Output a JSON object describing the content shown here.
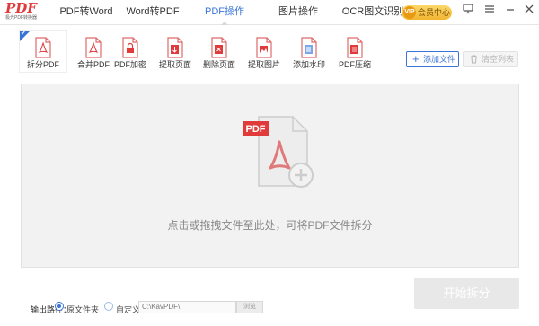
{
  "app": {
    "logo_text": "PDF",
    "logo_subtitle": "极光PDF转换器"
  },
  "main_tabs": [
    {
      "label": "PDF转Word",
      "active": false
    },
    {
      "label": "Word转PDF",
      "active": false
    },
    {
      "label": "PDF操作",
      "active": true
    },
    {
      "label": "图片操作",
      "active": false
    },
    {
      "label": "OCR图文识别",
      "active": false
    }
  ],
  "header": {
    "vip_label": "会员中心",
    "vip_badge": "VIP"
  },
  "window_controls": [
    "user-icon",
    "menu-icon",
    "minimize-icon",
    "close-icon"
  ],
  "tools": [
    {
      "label": "拆分PDF",
      "icon": "split-pdf-icon",
      "active": true
    },
    {
      "label": "合并PDF",
      "icon": "merge-pdf-icon",
      "active": false
    },
    {
      "label": "PDF加密",
      "icon": "encrypt-pdf-icon",
      "active": false
    },
    {
      "label": "提取页面",
      "icon": "extract-pages-icon",
      "active": false
    },
    {
      "label": "删除页面",
      "icon": "delete-pages-icon",
      "active": false
    },
    {
      "label": "提取图片",
      "icon": "extract-images-icon",
      "active": false
    },
    {
      "label": "添加水印",
      "icon": "add-watermark-icon",
      "active": false
    },
    {
      "label": "PDF压缩",
      "icon": "compress-pdf-icon",
      "active": false
    }
  ],
  "actions": {
    "add_file": "添加文件",
    "clear_list": "清空列表"
  },
  "dropzone": {
    "badge": "PDF",
    "hint": "点击或拖拽文件至此处，可将PDF文件拆分"
  },
  "output": {
    "label": "输出路径：",
    "option_original": "原文件夹",
    "option_custom": "自定义",
    "selected": "原文件夹",
    "path": "C:\\KavPDF\\",
    "browse": "浏览"
  },
  "start_button": "开始拆分",
  "colors": {
    "accent": "#3a74d6",
    "pdf_red": "#e03a3a",
    "dropzone_bg": "#f2f2f2",
    "disabled_button": "#e8e8e8"
  }
}
